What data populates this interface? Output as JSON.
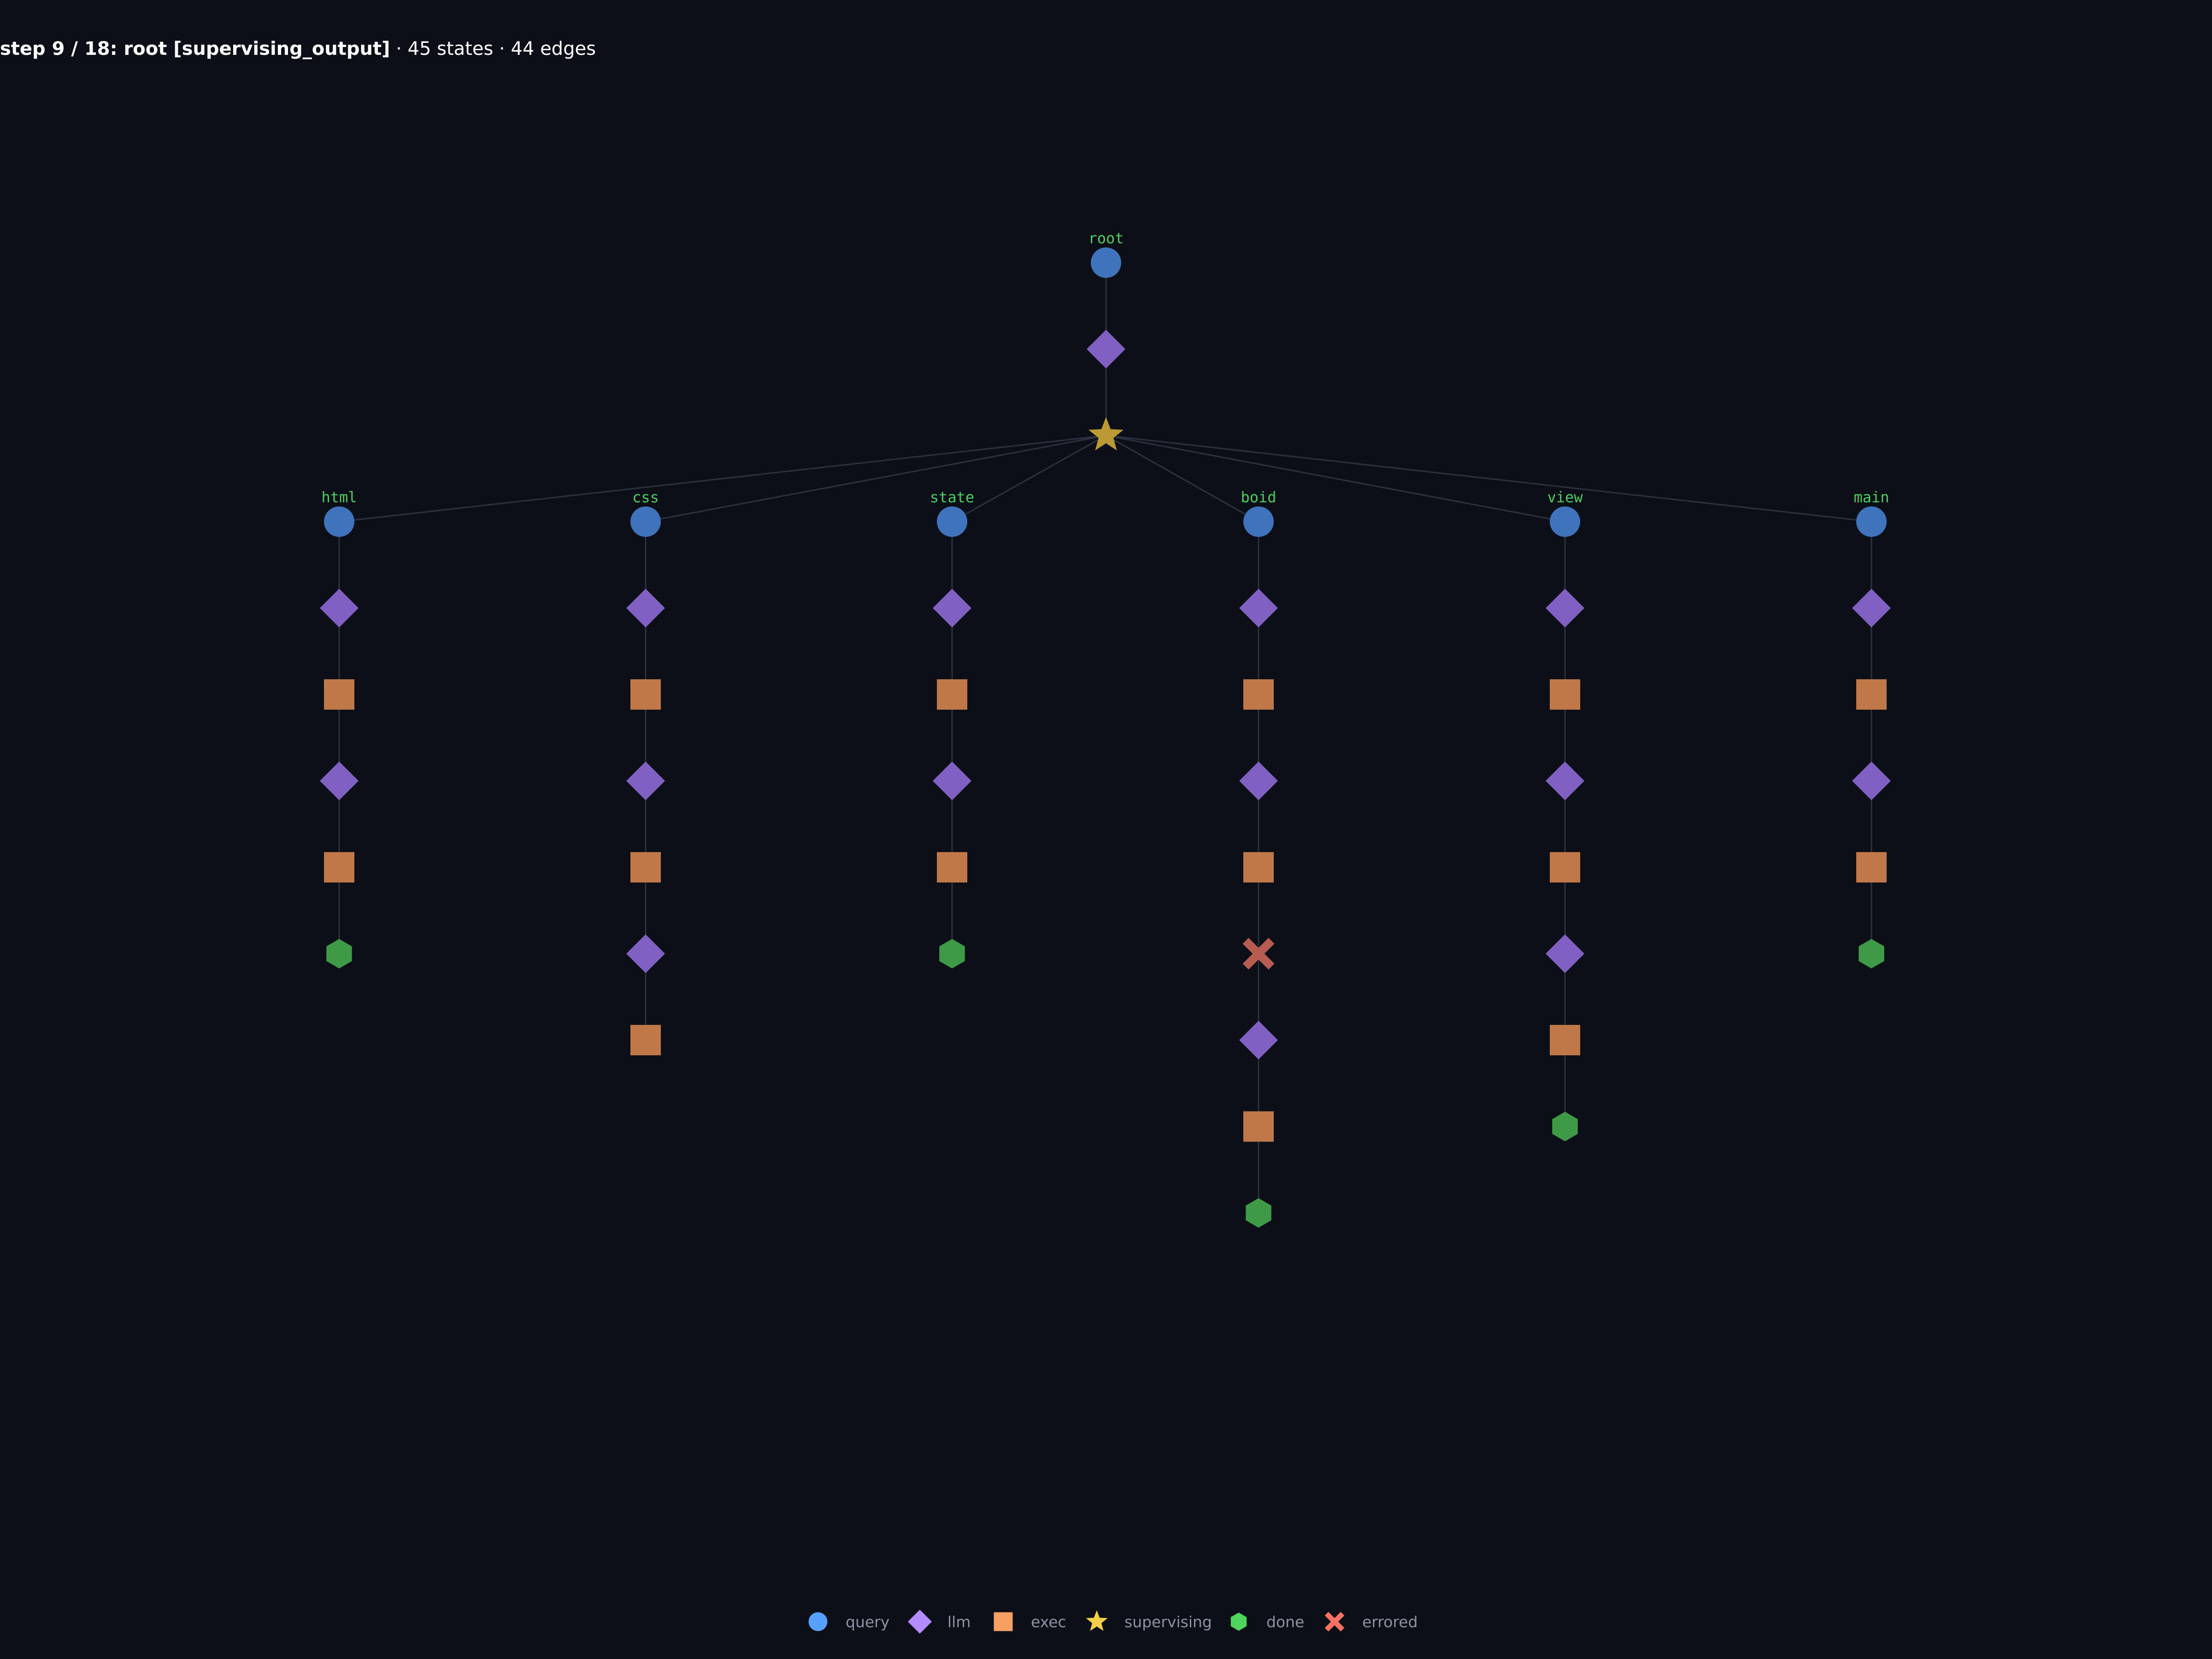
{
  "header": {
    "step_prefix": "step",
    "step_current": "9",
    "step_total": "18",
    "state_name": "root",
    "state_kind": "[supervising_output]",
    "states_text": "45 states",
    "edges_text": "44 edges",
    "separator": "·"
  },
  "colors": {
    "background": "#0c0f17",
    "header_text": "#ffffff",
    "label_text": "#4ccf62",
    "edge": "#2c3240",
    "legend_text": "#8c93a3"
  },
  "node_types": {
    "query": {
      "label": "query",
      "shape": "circle-icon",
      "node_color": "#3f73bc",
      "legend_color": "#57a0ff"
    },
    "llm": {
      "label": "llm",
      "shape": "diamond-icon",
      "node_color": "#8060c2",
      "legend_color": "#b48cff"
    },
    "exec": {
      "label": "exec",
      "shape": "square-icon",
      "node_color": "#c07848",
      "legend_color": "#f6a064"
    },
    "supervising": {
      "label": "supervising",
      "shape": "star-icon",
      "node_color": "#bb9a35",
      "legend_color": "#f6cf47"
    },
    "done": {
      "label": "done",
      "shape": "hexagon-icon",
      "node_color": "#3f9a48",
      "legend_color": "#4fd45e"
    },
    "errored": {
      "label": "errored",
      "shape": "x-cross-icon",
      "node_color": "#b85c52",
      "legend_color": "#f87162"
    }
  },
  "legend": [
    "query",
    "llm",
    "exec",
    "supervising",
    "done",
    "errored"
  ],
  "root_chain": {
    "label": "root",
    "nodes": [
      "query",
      "llm",
      "supervising"
    ]
  },
  "branches": [
    {
      "label": "html",
      "nodes": [
        "query",
        "llm",
        "exec",
        "llm",
        "exec",
        "done"
      ]
    },
    {
      "label": "css",
      "nodes": [
        "query",
        "llm",
        "exec",
        "llm",
        "exec",
        "llm",
        "exec"
      ]
    },
    {
      "label": "state",
      "nodes": [
        "query",
        "llm",
        "exec",
        "llm",
        "exec",
        "done"
      ]
    },
    {
      "label": "boid",
      "nodes": [
        "query",
        "llm",
        "exec",
        "llm",
        "exec",
        "errored",
        "llm",
        "exec",
        "done"
      ]
    },
    {
      "label": "view",
      "nodes": [
        "query",
        "llm",
        "exec",
        "llm",
        "exec",
        "llm",
        "exec",
        "done"
      ]
    },
    {
      "label": "main",
      "nodes": [
        "query",
        "llm",
        "exec",
        "llm",
        "exec",
        "done"
      ]
    }
  ]
}
